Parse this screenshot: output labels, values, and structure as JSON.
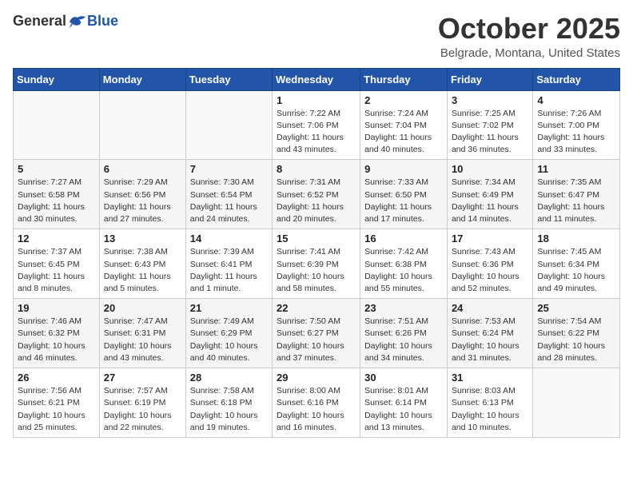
{
  "header": {
    "logo_general": "General",
    "logo_blue": "Blue",
    "title": "October 2025",
    "location": "Belgrade, Montana, United States"
  },
  "weekdays": [
    "Sunday",
    "Monday",
    "Tuesday",
    "Wednesday",
    "Thursday",
    "Friday",
    "Saturday"
  ],
  "weeks": [
    [
      {
        "day": "",
        "info": ""
      },
      {
        "day": "",
        "info": ""
      },
      {
        "day": "",
        "info": ""
      },
      {
        "day": "1",
        "info": "Sunrise: 7:22 AM\nSunset: 7:06 PM\nDaylight: 11 hours\nand 43 minutes."
      },
      {
        "day": "2",
        "info": "Sunrise: 7:24 AM\nSunset: 7:04 PM\nDaylight: 11 hours\nand 40 minutes."
      },
      {
        "day": "3",
        "info": "Sunrise: 7:25 AM\nSunset: 7:02 PM\nDaylight: 11 hours\nand 36 minutes."
      },
      {
        "day": "4",
        "info": "Sunrise: 7:26 AM\nSunset: 7:00 PM\nDaylight: 11 hours\nand 33 minutes."
      }
    ],
    [
      {
        "day": "5",
        "info": "Sunrise: 7:27 AM\nSunset: 6:58 PM\nDaylight: 11 hours\nand 30 minutes."
      },
      {
        "day": "6",
        "info": "Sunrise: 7:29 AM\nSunset: 6:56 PM\nDaylight: 11 hours\nand 27 minutes."
      },
      {
        "day": "7",
        "info": "Sunrise: 7:30 AM\nSunset: 6:54 PM\nDaylight: 11 hours\nand 24 minutes."
      },
      {
        "day": "8",
        "info": "Sunrise: 7:31 AM\nSunset: 6:52 PM\nDaylight: 11 hours\nand 20 minutes."
      },
      {
        "day": "9",
        "info": "Sunrise: 7:33 AM\nSunset: 6:50 PM\nDaylight: 11 hours\nand 17 minutes."
      },
      {
        "day": "10",
        "info": "Sunrise: 7:34 AM\nSunset: 6:49 PM\nDaylight: 11 hours\nand 14 minutes."
      },
      {
        "day": "11",
        "info": "Sunrise: 7:35 AM\nSunset: 6:47 PM\nDaylight: 11 hours\nand 11 minutes."
      }
    ],
    [
      {
        "day": "12",
        "info": "Sunrise: 7:37 AM\nSunset: 6:45 PM\nDaylight: 11 hours\nand 8 minutes."
      },
      {
        "day": "13",
        "info": "Sunrise: 7:38 AM\nSunset: 6:43 PM\nDaylight: 11 hours\nand 5 minutes."
      },
      {
        "day": "14",
        "info": "Sunrise: 7:39 AM\nSunset: 6:41 PM\nDaylight: 11 hours\nand 1 minute."
      },
      {
        "day": "15",
        "info": "Sunrise: 7:41 AM\nSunset: 6:39 PM\nDaylight: 10 hours\nand 58 minutes."
      },
      {
        "day": "16",
        "info": "Sunrise: 7:42 AM\nSunset: 6:38 PM\nDaylight: 10 hours\nand 55 minutes."
      },
      {
        "day": "17",
        "info": "Sunrise: 7:43 AM\nSunset: 6:36 PM\nDaylight: 10 hours\nand 52 minutes."
      },
      {
        "day": "18",
        "info": "Sunrise: 7:45 AM\nSunset: 6:34 PM\nDaylight: 10 hours\nand 49 minutes."
      }
    ],
    [
      {
        "day": "19",
        "info": "Sunrise: 7:46 AM\nSunset: 6:32 PM\nDaylight: 10 hours\nand 46 minutes."
      },
      {
        "day": "20",
        "info": "Sunrise: 7:47 AM\nSunset: 6:31 PM\nDaylight: 10 hours\nand 43 minutes."
      },
      {
        "day": "21",
        "info": "Sunrise: 7:49 AM\nSunset: 6:29 PM\nDaylight: 10 hours\nand 40 minutes."
      },
      {
        "day": "22",
        "info": "Sunrise: 7:50 AM\nSunset: 6:27 PM\nDaylight: 10 hours\nand 37 minutes."
      },
      {
        "day": "23",
        "info": "Sunrise: 7:51 AM\nSunset: 6:26 PM\nDaylight: 10 hours\nand 34 minutes."
      },
      {
        "day": "24",
        "info": "Sunrise: 7:53 AM\nSunset: 6:24 PM\nDaylight: 10 hours\nand 31 minutes."
      },
      {
        "day": "25",
        "info": "Sunrise: 7:54 AM\nSunset: 6:22 PM\nDaylight: 10 hours\nand 28 minutes."
      }
    ],
    [
      {
        "day": "26",
        "info": "Sunrise: 7:56 AM\nSunset: 6:21 PM\nDaylight: 10 hours\nand 25 minutes."
      },
      {
        "day": "27",
        "info": "Sunrise: 7:57 AM\nSunset: 6:19 PM\nDaylight: 10 hours\nand 22 minutes."
      },
      {
        "day": "28",
        "info": "Sunrise: 7:58 AM\nSunset: 6:18 PM\nDaylight: 10 hours\nand 19 minutes."
      },
      {
        "day": "29",
        "info": "Sunrise: 8:00 AM\nSunset: 6:16 PM\nDaylight: 10 hours\nand 16 minutes."
      },
      {
        "day": "30",
        "info": "Sunrise: 8:01 AM\nSunset: 6:14 PM\nDaylight: 10 hours\nand 13 minutes."
      },
      {
        "day": "31",
        "info": "Sunrise: 8:03 AM\nSunset: 6:13 PM\nDaylight: 10 hours\nand 10 minutes."
      },
      {
        "day": "",
        "info": ""
      }
    ]
  ]
}
